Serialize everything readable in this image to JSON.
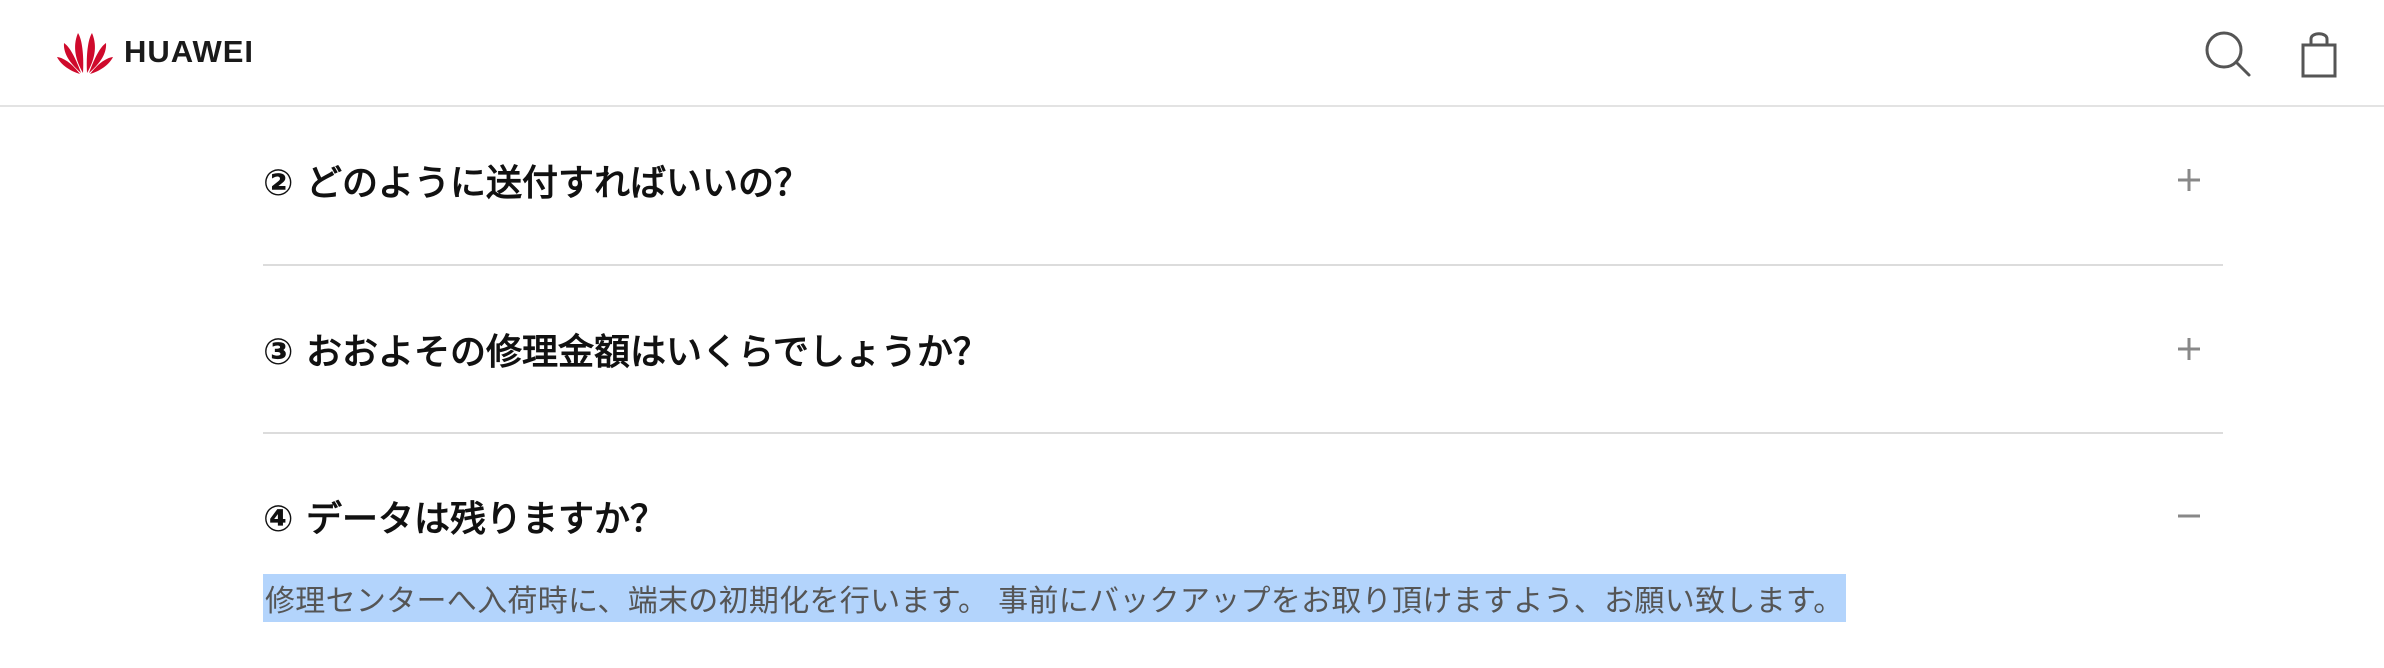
{
  "header": {
    "brand": "HUAWEI",
    "icons": [
      "search-icon",
      "shopping-bag-icon"
    ],
    "brand_color": "#cf0a2c"
  },
  "faq": {
    "items": [
      {
        "question": "② どのように送付すればいいの？",
        "state": "collapsed",
        "toggle": "plus-icon"
      },
      {
        "question": "③ おおよその修理金額はいくらでしょうか？",
        "state": "collapsed",
        "toggle": "plus-icon"
      },
      {
        "question": "④ データは残りますか？",
        "state": "expanded",
        "toggle": "minus-icon",
        "answer": "修理センターへ入荷時に、端末の初期化を行います。 事前にバックアップをお取り頂けますよう、お願い致します。"
      }
    ],
    "selection_color": "#b3d4fc"
  }
}
